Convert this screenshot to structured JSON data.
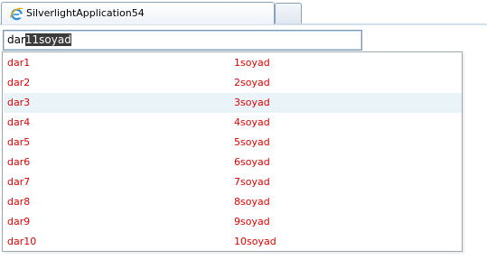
{
  "tab": {
    "title": "SilverlightApplication54",
    "icon": "ie-icon"
  },
  "search": {
    "typed": "dar",
    "autocomplete_selected": "11soyad"
  },
  "suggestions": [
    {
      "name": "dar1",
      "surname": "1soyad"
    },
    {
      "name": "dar2",
      "surname": "2soyad"
    },
    {
      "name": "dar3",
      "surname": "3soyad",
      "highlighted": true
    },
    {
      "name": "dar4",
      "surname": "4soyad"
    },
    {
      "name": "dar5",
      "surname": "5soyad"
    },
    {
      "name": "dar6",
      "surname": "6soyad"
    },
    {
      "name": "dar7",
      "surname": "7soyad"
    },
    {
      "name": "dar8",
      "surname": "8soyad"
    },
    {
      "name": "dar9",
      "surname": "9soyad"
    },
    {
      "name": "dar10",
      "surname": "10soyad"
    }
  ],
  "colors": {
    "suggestion_text": "#e00000",
    "hover_row": "#e9f3f8",
    "selection_bg": "#3b3b3b"
  }
}
